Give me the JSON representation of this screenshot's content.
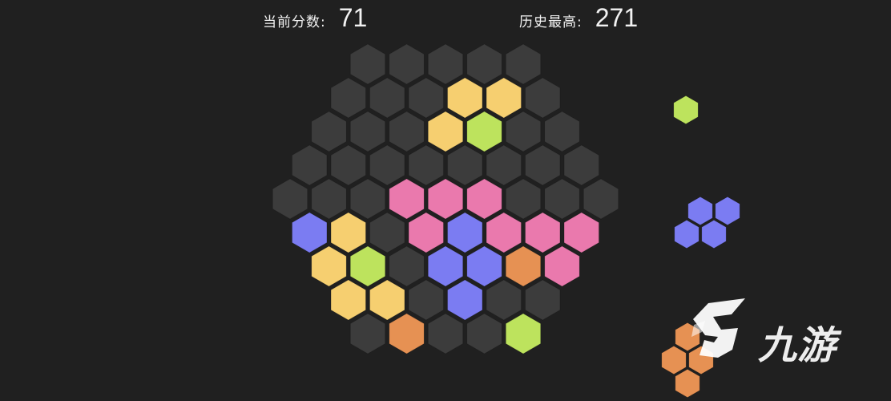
{
  "scores": {
    "current_label": "当前分数:",
    "current_value": "71",
    "best_label": "历史最高:",
    "best_value": "271"
  },
  "colors": {
    "background": "#202020",
    "empty": "#3c3c3c",
    "yellow": "#f6cf70",
    "green": "#bde35d",
    "pink": "#ea79ad",
    "blue": "#7b7cf2",
    "orange": "#e69153"
  },
  "board": {
    "radius": 4,
    "filled_cells": [
      {
        "q": 2,
        "r": -3,
        "color": "yellow"
      },
      {
        "q": 3,
        "r": -3,
        "color": "yellow"
      },
      {
        "q": 1,
        "r": -2,
        "color": "yellow"
      },
      {
        "q": 2,
        "r": -2,
        "color": "green"
      },
      {
        "q": -1,
        "r": 0,
        "color": "pink"
      },
      {
        "q": 0,
        "r": 0,
        "color": "pink"
      },
      {
        "q": 1,
        "r": 0,
        "color": "pink"
      },
      {
        "q": -4,
        "r": 1,
        "color": "blue"
      },
      {
        "q": -3,
        "r": 1,
        "color": "yellow"
      },
      {
        "q": -1,
        "r": 1,
        "color": "pink"
      },
      {
        "q": 0,
        "r": 1,
        "color": "blue"
      },
      {
        "q": 1,
        "r": 1,
        "color": "pink"
      },
      {
        "q": 2,
        "r": 1,
        "color": "pink"
      },
      {
        "q": 3,
        "r": 1,
        "color": "pink"
      },
      {
        "q": -4,
        "r": 2,
        "color": "yellow"
      },
      {
        "q": -3,
        "r": 2,
        "color": "green"
      },
      {
        "q": -1,
        "r": 2,
        "color": "blue"
      },
      {
        "q": 0,
        "r": 2,
        "color": "blue"
      },
      {
        "q": 1,
        "r": 2,
        "color": "orange"
      },
      {
        "q": 2,
        "r": 2,
        "color": "pink"
      },
      {
        "q": -4,
        "r": 3,
        "color": "yellow"
      },
      {
        "q": -3,
        "r": 3,
        "color": "yellow"
      },
      {
        "q": -1,
        "r": 3,
        "color": "blue"
      },
      {
        "q": -3,
        "r": 4,
        "color": "orange"
      },
      {
        "q": 0,
        "r": 4,
        "color": "green"
      }
    ]
  },
  "pieces": [
    {
      "name": "single",
      "color": "green",
      "cells": [
        {
          "q": 0,
          "r": 0
        }
      ]
    },
    {
      "name": "rhombus",
      "color": "blue",
      "cells": [
        {
          "q": 0,
          "r": 0
        },
        {
          "q": 1,
          "r": 0
        },
        {
          "q": -1,
          "r": 1
        },
        {
          "q": 0,
          "r": 1
        }
      ]
    },
    {
      "name": "triangle",
      "color": "orange",
      "cells": [
        {
          "q": 0,
          "r": 0
        },
        {
          "q": -1,
          "r": 1
        },
        {
          "q": 0,
          "r": 1
        },
        {
          "q": -1,
          "r": 2
        }
      ]
    }
  ],
  "watermark": {
    "text": "九游"
  }
}
